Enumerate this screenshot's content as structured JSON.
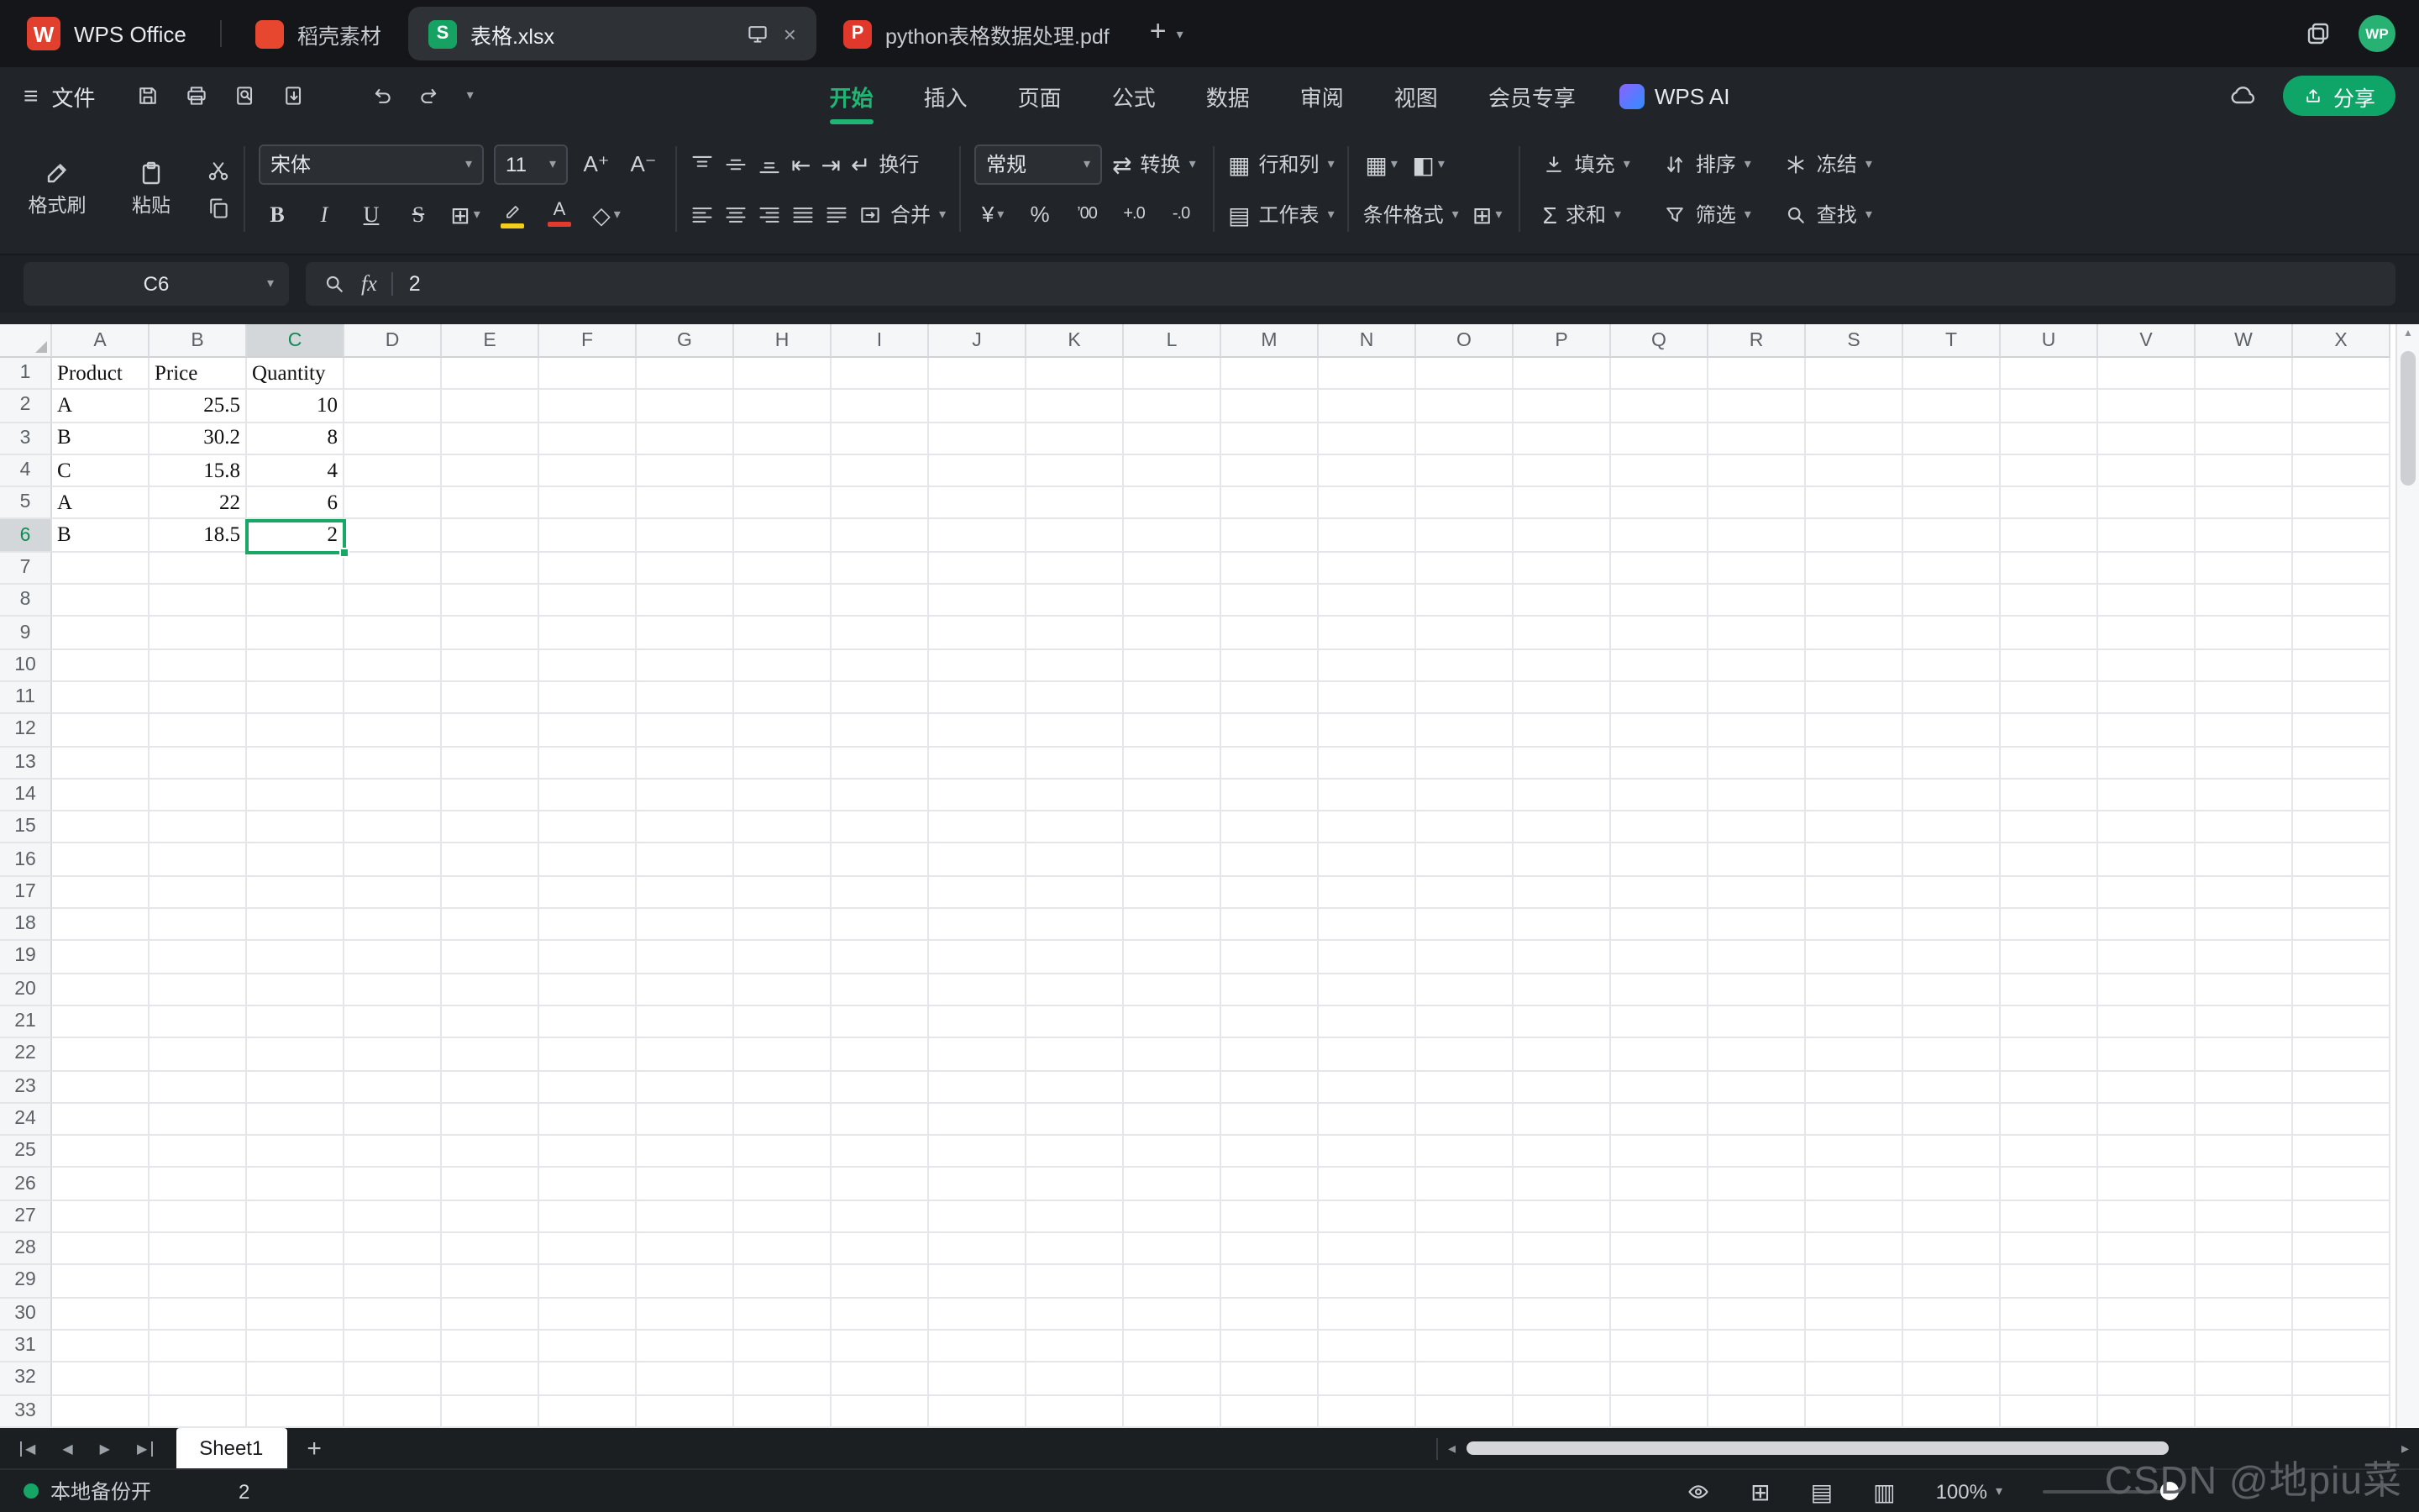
{
  "accent": "#18a765",
  "icons": {
    "hamburger": "≡",
    "caret_down": "▾",
    "app_logo": "W",
    "sheet_logo": "S",
    "pdf_logo": "P",
    "close": "×",
    "plus": "+",
    "font_grow": "A⁺",
    "font_shrink": "A⁻",
    "borders": "⊞",
    "shading": "◇",
    "indent_decrease": "⇤",
    "indent_increase": "⇥",
    "wrap_return": "↵",
    "convert": "⇄",
    "currency": "¥",
    "percent": "%",
    "thousands": "’00",
    "inc_decimal": "+.0",
    "dec_decimal": "-.0",
    "rows_cols": "▦",
    "worksheet": "▤",
    "table_style": "▦",
    "cell_style": "◧",
    "cond_small": "⊞",
    "sum": "Σ",
    "prev": "◀",
    "next": "▶",
    "up": "▲",
    "left_small": "◂",
    "right_small": "▸",
    "grid_plus": "⊞",
    "view_normal": "▤",
    "view_break": "▥"
  },
  "tab_bar": {
    "app_label": "WPS Office",
    "docer_tab": "稻壳素材",
    "doc_tabs": [
      {
        "label": "表格.xlsx",
        "type": "sheet",
        "active": true
      },
      {
        "label": "python表格数据处理.pdf",
        "type": "pdf",
        "active": false
      }
    ],
    "avatar": "WP"
  },
  "menu_bar": {
    "file": "文件",
    "tabs": [
      "开始",
      "插入",
      "页面",
      "公式",
      "数据",
      "审阅",
      "视图",
      "会员专享"
    ],
    "active_index": 0,
    "wps_ai": "WPS AI",
    "share": "分享"
  },
  "ribbon": {
    "format_painter": "格式刷",
    "paste": "粘贴",
    "font_name": "宋体",
    "font_size": "11",
    "bold": "B",
    "italic": "I",
    "underline": "U",
    "strike": "S",
    "wrap": "换行",
    "merge": "合并",
    "number_format": "常规",
    "convert": "转换",
    "rows_cols": "行和列",
    "worksheet": "工作表",
    "conditional": "条件格式",
    "fill": "填充",
    "sum": "求和",
    "sort": "排序",
    "filter": "筛选",
    "freeze": "冻结",
    "find": "查找"
  },
  "formula_bar": {
    "cell_ref": "C6",
    "fx": "fx",
    "value": "2"
  },
  "sheet": {
    "columns": [
      "A",
      "B",
      "C",
      "D",
      "E",
      "F",
      "G",
      "H",
      "I",
      "J",
      "K",
      "L",
      "M",
      "N",
      "O",
      "P",
      "Q",
      "R",
      "S",
      "T",
      "U",
      "V",
      "W",
      "X"
    ],
    "row_count": 34,
    "selection": {
      "cell": "C6",
      "col": "C",
      "row": 6
    },
    "cells": {
      "A1": "Product",
      "B1": "Price",
      "C1": "Quantity",
      "A2": "A",
      "B2": "25.5",
      "C2": "10",
      "A3": "B",
      "B3": "30.2",
      "C3": "8",
      "A4": "C",
      "B4": "15.8",
      "C4": "4",
      "A5": "A",
      "B5": "22",
      "C5": "6",
      "A6": "B",
      "B6": "18.5",
      "C6": "2"
    }
  },
  "sheet_bar": {
    "sheet_name": "Sheet1"
  },
  "status_bar": {
    "backup": "本地备份开",
    "value": "2",
    "zoom": "100%"
  },
  "watermark": "CSDN @地piu菜"
}
